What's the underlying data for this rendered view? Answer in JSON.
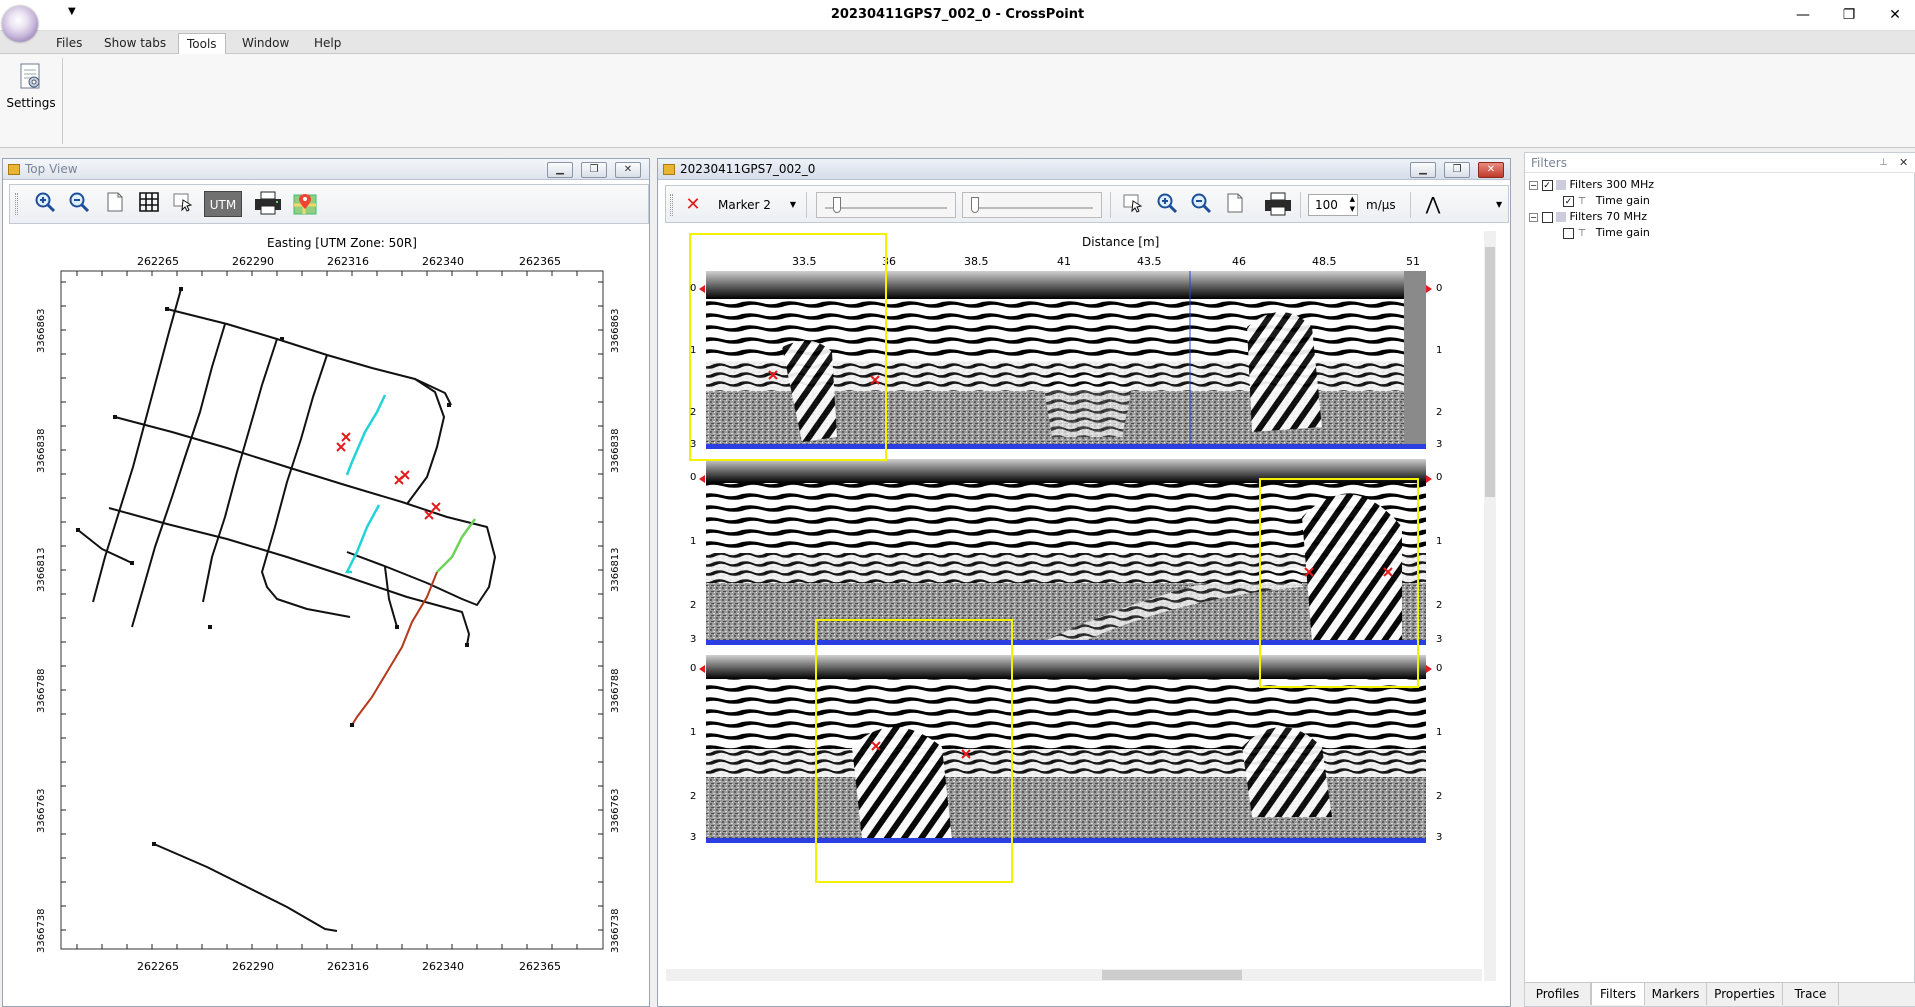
{
  "window": {
    "title": "20230411GPS7_002_0 - CrossPoint",
    "controls": {
      "minimize": "—",
      "restore": "❐",
      "close": "✕"
    }
  },
  "menu": [
    "Files",
    "Show tabs",
    "Tools",
    "Window",
    "Help"
  ],
  "menu_active": "Tools",
  "ribbon": {
    "settings_label": "Settings"
  },
  "top_view": {
    "title": "Top View",
    "toolbar": [
      "zoom-in",
      "zoom-out",
      "page",
      "grid",
      "select-cursor",
      "UTM",
      "print",
      "map-pin"
    ],
    "utm_label": "UTM",
    "x_axis_label": "Easting [UTM Zone: 50R]",
    "x_ticks": [
      "262265",
      "262290",
      "262316",
      "262340",
      "262365"
    ],
    "y_ticks": [
      "3366863",
      "3366838",
      "3366813",
      "3366788",
      "3366763",
      "3366738"
    ]
  },
  "profile_view": {
    "title": "20230411GPS7_002_0",
    "marker_label": "Marker 2",
    "velocity_value": "100",
    "velocity_unit": "m/μs",
    "distance_label": "Distance [m]",
    "distance_ticks": [
      "33.5",
      "36",
      "38.5",
      "41",
      "43.5",
      "46",
      "48.5",
      "51"
    ],
    "depth_ticks": [
      "0",
      "1",
      "2",
      "3"
    ]
  },
  "filters": {
    "title": "Filters",
    "tree": [
      {
        "label": "Filters  300 MHz",
        "checked": true,
        "children": [
          {
            "label": "Time gain",
            "checked": true
          }
        ]
      },
      {
        "label": "Filters  70 MHz",
        "checked": false,
        "children": [
          {
            "label": "Time gain",
            "checked": false
          }
        ]
      }
    ],
    "tabs": [
      "Profiles",
      "Filters",
      "Markers",
      "Properties",
      "Trace"
    ],
    "active_tab": "Filters"
  },
  "colors": {
    "accent_blue": "#2b3fe0",
    "highlight_yellow": "#f2f200",
    "marker_red": "#e31b1b",
    "track_cyan": "#22d4d8",
    "track_green": "#6fd15a",
    "track_brown": "#b5391c"
  }
}
